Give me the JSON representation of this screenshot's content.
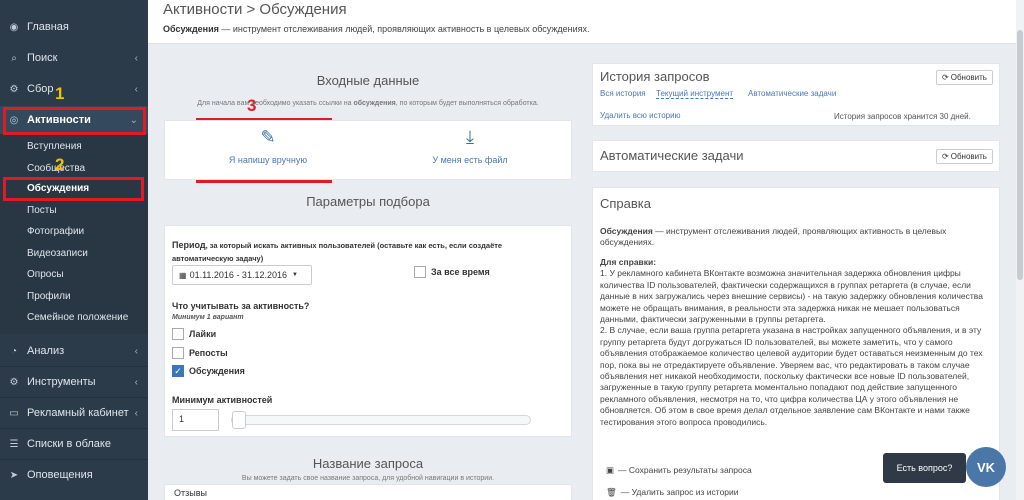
{
  "sidebar": {
    "items": [
      {
        "label": "Главная",
        "icon": "gauge-icon"
      },
      {
        "label": "Поиск",
        "icon": "search-icon"
      },
      {
        "label": "Сбор",
        "icon": "gear-icon"
      },
      {
        "label": "Активности",
        "icon": "eye-icon"
      },
      {
        "label": "Анализ",
        "icon": "pie-chart-icon"
      },
      {
        "label": "Инструменты",
        "icon": "cogs-icon"
      },
      {
        "label": "Рекламный кабинет",
        "icon": "monitor-icon"
      },
      {
        "label": "Списки в облаке",
        "icon": "list-icon"
      },
      {
        "label": "Оповещения",
        "icon": "send-icon"
      }
    ],
    "subitems": [
      "Вступления",
      "Сообщества",
      "Обсуждения",
      "Посты",
      "Фотографии",
      "Видеозаписи",
      "Опросы",
      "Профили",
      "Семейное положение"
    ]
  },
  "annotations": {
    "n1": "1",
    "n2": "2",
    "n3": "3",
    "color": "#e01b24",
    "num_color": "#f2c200"
  },
  "page": {
    "title": "Активности > Обсуждения",
    "desc_bold": "Обсуждения",
    "desc_rest": " — инструмент отслеживания людей, проявляющих активность в целевых обсуждениях."
  },
  "input_section": {
    "title": "Входные данные",
    "hint_pre": "Для начала вам необходимо указать ссылки на ",
    "hint_bold": "обсуждения",
    "hint_post": ", по которым будет выполняться обработка.",
    "manual_label": "Я напишу вручную",
    "file_label": "У меня есть файл"
  },
  "params": {
    "title": "Параметры подбора",
    "period_bold": "Период",
    "period_rest": ", за который искать активных пользователей (оставьте как есть, если создаёте автоматическую задачу)",
    "date_range": "01.11.2016 - 31.12.2016",
    "all_time": "За все время",
    "count_label": "Что учитывать за активность?",
    "min_one": "Минимум 1 вариант",
    "opt_likes": "Лайки",
    "opt_reposts": "Репосты",
    "opt_discussions": "Обсуждения",
    "opt_discussions_checked": true,
    "min_activity_label": "Минимум активностей",
    "min_activity_value": "1"
  },
  "query_name": {
    "title": "Название запроса",
    "hint": "Вы можете задать свое название запроса, для удобной навигации в истории.",
    "value": "Отзывы"
  },
  "history": {
    "title": "История запросов",
    "refresh": "Обновить",
    "tab_all": "Вся история",
    "tab_current": "Текущий инструмент",
    "tab_auto": "Автоматические задачи",
    "delete_all": "Удалить всю историю",
    "retention": "История запросов хранится 30 дней."
  },
  "auto_tasks": {
    "title": "Автоматические задачи",
    "refresh": "Обновить"
  },
  "help": {
    "title": "Справка",
    "intro_bold": "Обсуждения",
    "intro_rest": " — инструмент отслеживания людей, проявляющих активность в целевых обсуждениях.",
    "note_title": "Для справки:",
    "p1": "1. У рекламного кабинета ВКонтакте возможна значительная задержка обновления цифры количества ID пользователей, фактически содержащихся в группах ретаргета (в случае, если данные в них загружались через внешние сервисы) - на такую задержку обновления количества можете не обращать внимания, в реальности эта задержка никак не мешает пользоваться данными, фактически загруженными в группы ретаргета.",
    "p2": "2. В случае, если ваша группа ретаргета указана в настройках запущенного объявления, и в эту группу ретаргета будут догружаться ID пользователей, вы можете заметить, что у самого объявления отображаемое количество целевой аудитории будет оставаться неизменным до тех пор, пока вы не отредактируете объявление. Уверяем вас, что редактировать в таком случае объявления нет никакой необходимости, поскольку фактически все новые ID пользователей, загруженные в такую группу ретаргета моментально попадают под действие запущенного рекламного объявления, несмотря на то, что цифра количества ЦА у этого объявления не обновляется. Об этом в свое время делал отдельное заявление сам ВКонтакте и нами также тестирования этого вопроса проводились.",
    "save": "— Сохранить результаты запроса",
    "delete": "— Удалить запрос из истории"
  },
  "vk": {
    "tip": "Есть вопрос?",
    "logo": "VK"
  }
}
